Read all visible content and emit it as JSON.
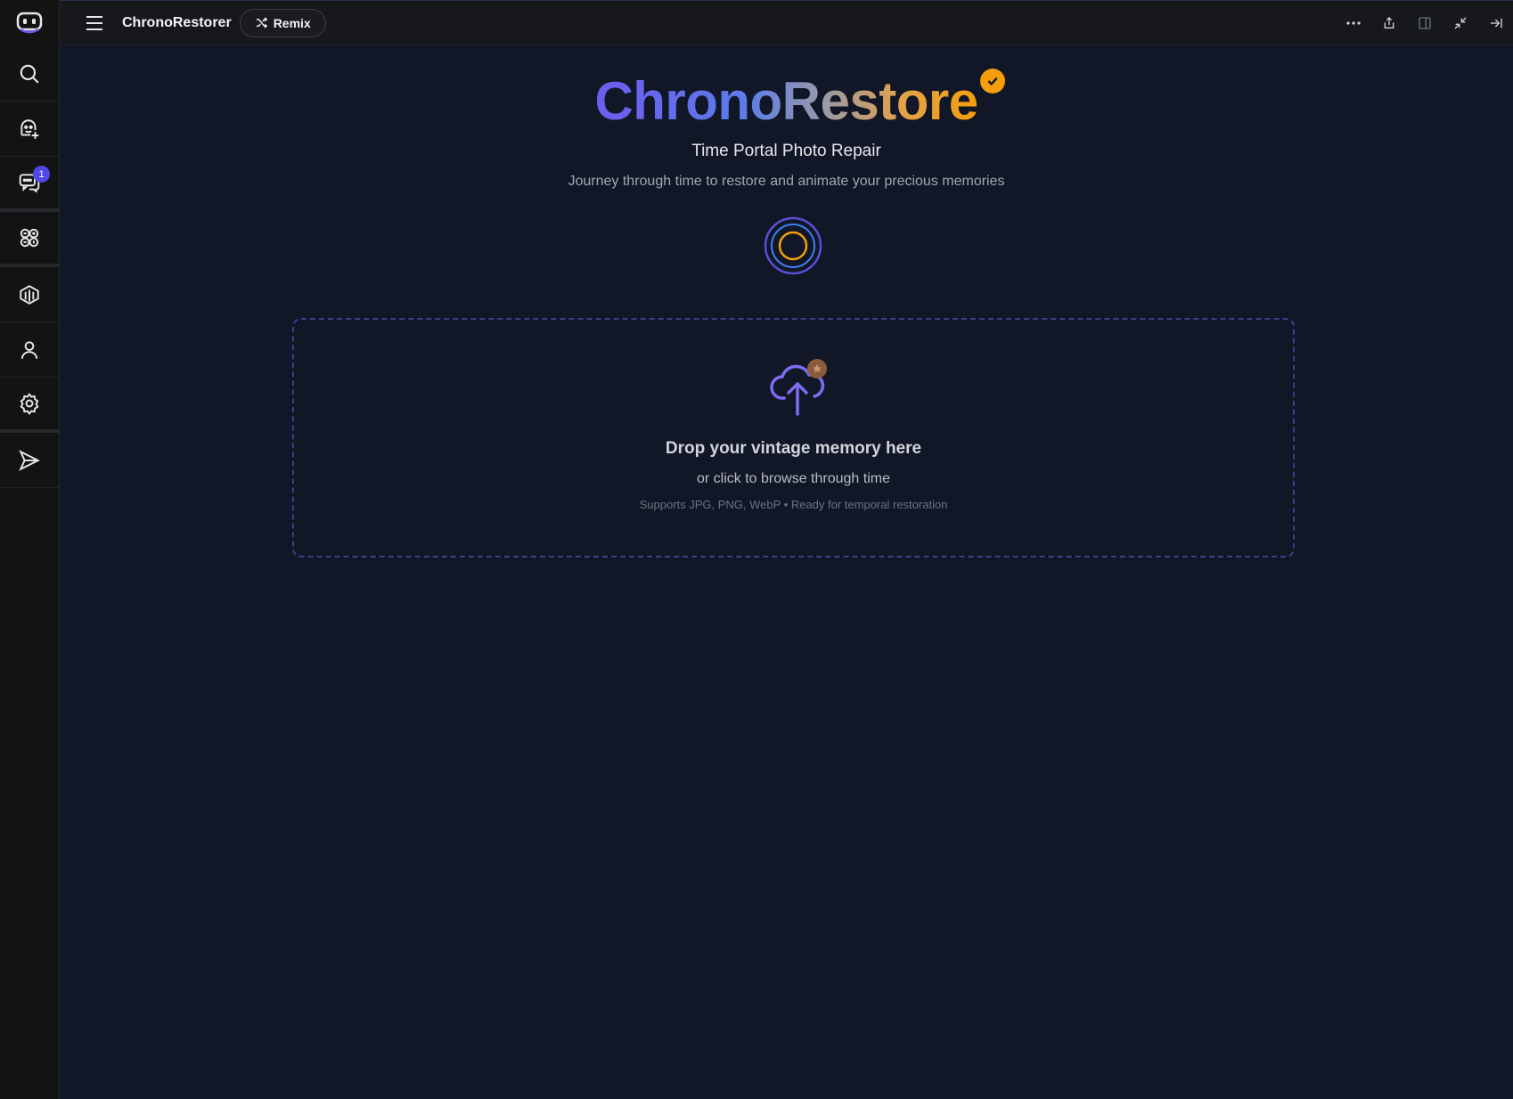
{
  "topbar": {
    "app_title": "ChronoRestorer",
    "remix_label": "Remix"
  },
  "sidebar": {
    "chat_badge": "1",
    "items": [
      {
        "icon": "search-icon"
      },
      {
        "icon": "add-bot-icon"
      },
      {
        "icon": "chat-icon"
      },
      {
        "icon": "apps-icon"
      },
      {
        "icon": "library-icon"
      },
      {
        "icon": "user-icon"
      },
      {
        "icon": "settings-icon"
      },
      {
        "icon": "send-icon"
      }
    ]
  },
  "hero": {
    "brand": "ChronoRestore",
    "subtitle": "Time Portal Photo Repair",
    "tagline": "Journey through time to restore and animate your precious memories"
  },
  "dropzone": {
    "title": "Drop your vintage memory here",
    "subtitle": "or click to browse through time",
    "note": "Supports JPG, PNG, WebP • Ready for temporal restoration"
  },
  "colors": {
    "background": "#111726",
    "accent": "#5046e5",
    "gold": "#f59e0b"
  }
}
